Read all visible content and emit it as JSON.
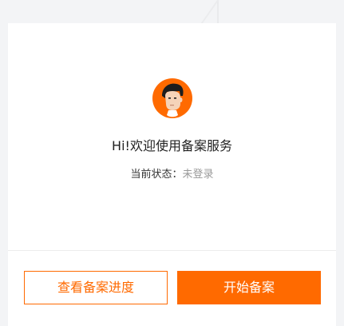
{
  "profile": {
    "greeting": "Hi!欢迎使用备案服务",
    "status_label": "当前状态：",
    "status_value": "未登录",
    "avatar_icon": "user-avatar-icon"
  },
  "actions": {
    "view_progress_label": "查看备案进度",
    "start_label": "开始备案"
  },
  "colors": {
    "accent": "#ff6a00",
    "text_primary": "#222222",
    "text_muted": "#999999"
  }
}
